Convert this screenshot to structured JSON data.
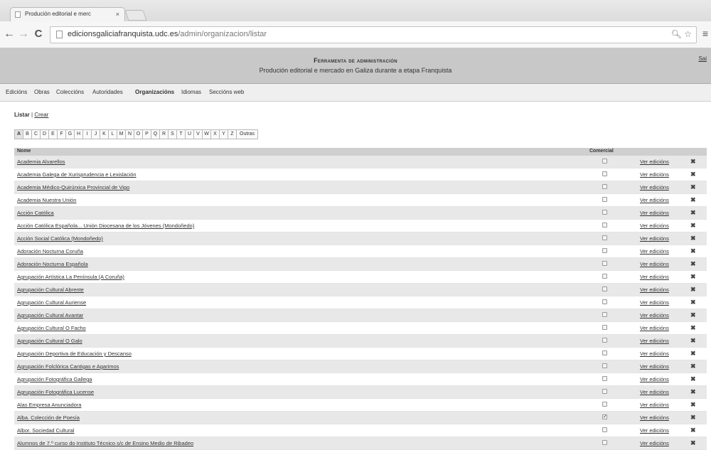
{
  "browser": {
    "tab_title": "Produción editorial e merc",
    "tab_close": "×",
    "url_host": "edicionsgaliciafranquista.udc.es",
    "url_path": "/admin/organizacion/listar",
    "icons": [
      "back-icon",
      "forward-icon",
      "reload-icon",
      "zoom-icon",
      "star-icon",
      "menu-icon"
    ]
  },
  "header": {
    "title": "Ferramenta de administración",
    "subtitle": "Produción editorial e mercado en Galiza durante a etapa Franquista",
    "corner": "Sai"
  },
  "nav": {
    "items": [
      {
        "label": "Edicións"
      },
      {
        "label": "Obras"
      },
      {
        "label": "Coleccións"
      },
      {
        "label": "Autoridades"
      },
      {
        "label": "Organizacións"
      },
      {
        "label": "Idiomas"
      },
      {
        "label": "Seccións web"
      }
    ],
    "active": "Organizacións"
  },
  "subnav": {
    "list_label": "Listar",
    "separator": " | ",
    "create_label": "Crear"
  },
  "letters": [
    "A",
    "B",
    "C",
    "D",
    "E",
    "F",
    "G",
    "H",
    "I",
    "J",
    "K",
    "L",
    "M",
    "N",
    "O",
    "P",
    "Q",
    "R",
    "S",
    "T",
    "U",
    "V",
    "W",
    "X",
    "Y",
    "Z",
    "Outras"
  ],
  "active_letter": "A",
  "table": {
    "col_name": "Nome",
    "col_commercial": "Comercial",
    "see_label": "Ver edicións",
    "delete_glyph": "✖",
    "rows": [
      {
        "name": "Academia Alvarellos",
        "commercial": false
      },
      {
        "name": "Academia Galega de Xurisprudencia e Lexislación",
        "commercial": false
      },
      {
        "name": "Academia Médico-Quirúrxica Provincial de Vigo",
        "commercial": false
      },
      {
        "name": "Academia Nuestra Unión",
        "commercial": false
      },
      {
        "name": "Acción Católica",
        "commercial": false
      },
      {
        "name": "Acción Católica Española... Unión Diocesana de los Jóvenes (Mondoñedo)",
        "commercial": false
      },
      {
        "name": "Acción Social Católica (Mondoñedo)",
        "commercial": false
      },
      {
        "name": "Adoración Nocturna Coruña",
        "commercial": false
      },
      {
        "name": "Adoración Nocturna Española",
        "commercial": false
      },
      {
        "name": "Agrupación Artística La Península (A Coruña)",
        "commercial": false
      },
      {
        "name": "Agrupación Cultural Abrente",
        "commercial": false
      },
      {
        "name": "Agrupación Cultural Auriense",
        "commercial": false
      },
      {
        "name": "Agrupación Cultural Avantar",
        "commercial": false
      },
      {
        "name": "Agrupación Cultural O Facho",
        "commercial": false
      },
      {
        "name": "Agrupación Cultural O Galo",
        "commercial": false
      },
      {
        "name": "Agrupación Deportiva de Educación y Descanso",
        "commercial": false
      },
      {
        "name": "Agrupación Folclórica Cantigas e Agarimos",
        "commercial": false
      },
      {
        "name": "Agrupación Fotográfica Gallega",
        "commercial": false
      },
      {
        "name": "Agrupación Fotográfica Lucense",
        "commercial": false
      },
      {
        "name": "Alas Empresa Anunciadora",
        "commercial": false
      },
      {
        "name": "Alba. Colección de Poesía",
        "commercial": true
      },
      {
        "name": "Albor. Sociedad Cultural",
        "commercial": false
      },
      {
        "name": "Alumnos de 7.º curso do Instituto Técnico s/c de Ensino Medio de Ribadeo",
        "commercial": false
      }
    ]
  }
}
